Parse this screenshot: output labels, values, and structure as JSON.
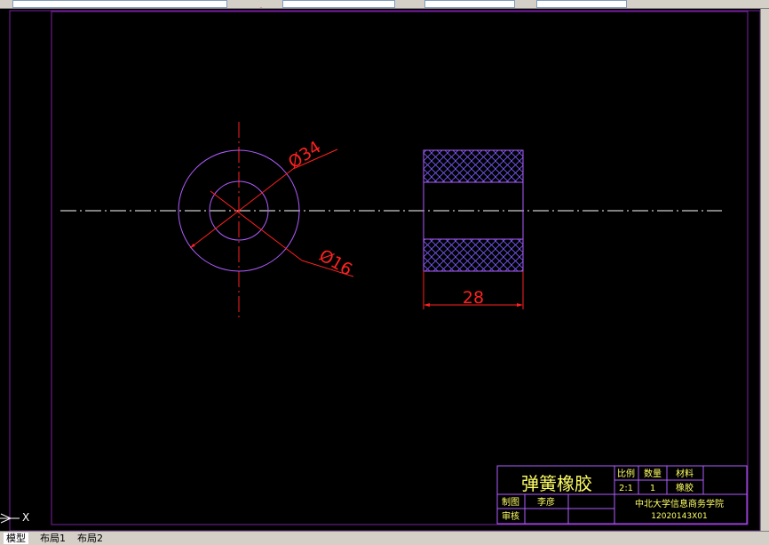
{
  "drawing": {
    "dimensions": {
      "outer_diameter": "Ø34",
      "inner_diameter": "Ø16",
      "width": "28"
    }
  },
  "title_block": {
    "part_name": "弹簧橡胶",
    "scale_label": "比例",
    "scale_value": "2:1",
    "quantity_label": "数量",
    "quantity_value": "1",
    "material_label": "材料",
    "material_value": "橡胶",
    "drawn_label": "制图",
    "drawn_by": "李彦",
    "checked_label": "审核",
    "school": "中北大学信息商务学院",
    "drawing_number": "12020143X01"
  },
  "ucs_icon": {
    "x_label": "X"
  },
  "tabs": [
    {
      "label": "模型",
      "active": true
    },
    {
      "label": "布局1",
      "active": false
    },
    {
      "label": "布局2",
      "active": false
    }
  ],
  "colors": {
    "background": "#000000",
    "border": "#7a1fa2",
    "outline": "#b05cff",
    "dimension": "#ff2020",
    "centerline": "#ffffff",
    "text_yellow": "#ffff66"
  }
}
